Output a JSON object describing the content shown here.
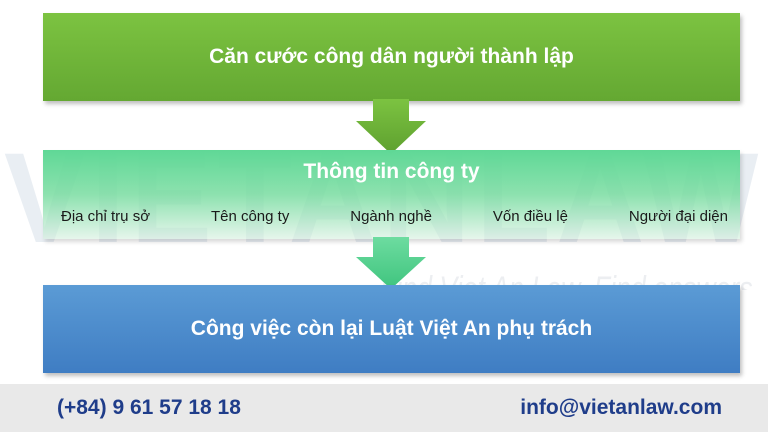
{
  "watermark": {
    "brand": "VIETANLAW",
    "slogan": "Find Viet An Law, Find answers."
  },
  "steps": {
    "step1": "Căn cước công dân người thành lập",
    "step2": {
      "title": "Thông tin công ty",
      "items": [
        "Địa chỉ trụ sở",
        "Tên công ty",
        "Ngành nghề",
        "Vốn điều lệ",
        "Người đại diện"
      ]
    },
    "step3": "Công việc còn lại Luật Việt An phụ trách"
  },
  "footer": {
    "phone": "(+84) 9 61 57 18 18",
    "email": "info@vietanlaw.com"
  },
  "colors": {
    "green": "#70b53a",
    "teal": "#5fd896",
    "blue": "#4a8bcc",
    "footer_text": "#1f3d8a"
  }
}
